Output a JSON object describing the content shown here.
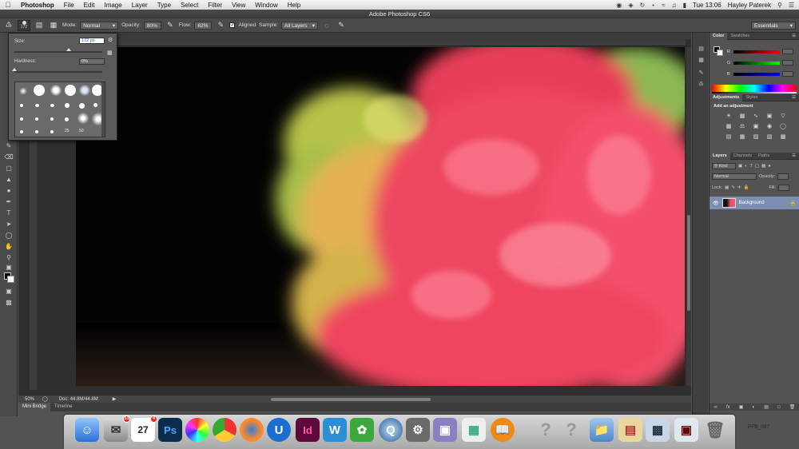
{
  "menubar": {
    "apple": "",
    "app_name": "Photoshop",
    "items": [
      "File",
      "Edit",
      "Image",
      "Layer",
      "Type",
      "Select",
      "Filter",
      "View",
      "Window",
      "Help"
    ],
    "clock": "Tue 13:06",
    "user": "Hayley Paterek"
  },
  "window": {
    "title": "Adobe Photoshop CS6"
  },
  "options_bar": {
    "brush_size": "172",
    "mode_label": "Mode:",
    "mode_value": "Normal",
    "opacity_label": "Opacity:",
    "opacity_value": "80%",
    "flow_label": "Flow:",
    "flow_value": "62%",
    "aligned_label": "Aligned",
    "sample_label": "Sample:",
    "sample_value": "All Layers",
    "workspace_value": "Essentials"
  },
  "brush_popup": {
    "size_label": "Size:",
    "size_value": "172 px",
    "size_fraction": 0.62,
    "hardness_label": "Hardness:",
    "hardness_value": "0%",
    "hardness_fraction": 0.0,
    "preset_labels": [
      "25",
      "50"
    ]
  },
  "statusbar": {
    "zoom": "50%",
    "doc": "Doc: 44.8M/44.8M"
  },
  "bottom_tabs": [
    "Mini Bridge",
    "Timeline"
  ],
  "color_panel": {
    "tabs": [
      "Color",
      "Swatches"
    ],
    "channels": [
      "R",
      "G",
      "B"
    ]
  },
  "adjustments_panel": {
    "tabs": [
      "Adjustments",
      "Styles"
    ],
    "title": "Add an adjustment"
  },
  "layers_panel": {
    "tabs": [
      "Layers",
      "Channels",
      "Paths"
    ],
    "kind_label": "Kind",
    "blend_mode": "Normal",
    "opacity_label": "Opacity:",
    "lock_label": "Lock:",
    "fill_label": "Fill:",
    "layer_name": "Background"
  },
  "dock": {
    "calendar_day": "27",
    "calendar_badge": "4",
    "mail_badge": "11",
    "right_label": "PFB_037"
  },
  "colors": {
    "accent": "#7d8fb0",
    "canvas_bg": "#060504",
    "smoke_pink": "#f0455f",
    "smoke_yellow": "#d8c94a",
    "smoke_green": "#9fc24c"
  }
}
